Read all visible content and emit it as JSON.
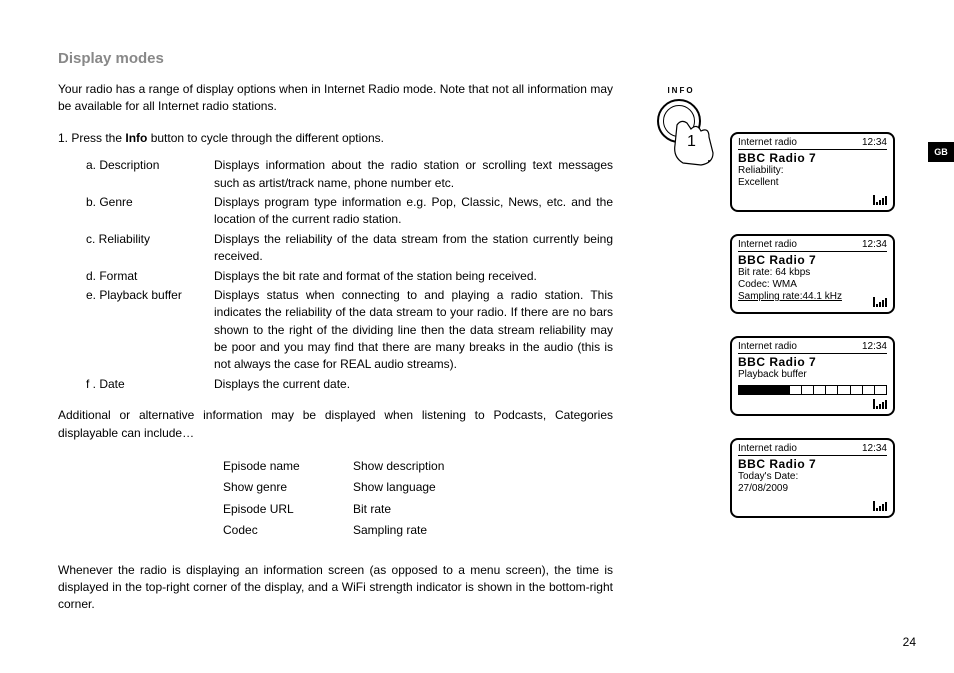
{
  "heading": "Display modes",
  "intro": "Your radio has a range of display options when in Internet Radio mode. Note that not all information may be available for all Internet radio stations.",
  "step1_prefix": "1. Press the ",
  "step1_bold": "Info",
  "step1_suffix": " button to cycle through the different options.",
  "options": [
    {
      "label": "a. Description",
      "desc": "Displays information about the radio station or scrolling text messages such as artist/track name, phone number etc."
    },
    {
      "label": "b. Genre",
      "desc": "Displays program type information e.g. Pop, Classic, News, etc. and the location of the current radio station."
    },
    {
      "label": "c. Reliability",
      "desc": "Displays the reliability of the data stream from the station currently being received."
    },
    {
      "label": "d. Format",
      "desc": "Displays the bit rate and format of the station being received."
    },
    {
      "label": "e. Playback buffer",
      "desc": "Displays status when connecting to and playing a radio station. This indicates the reliability of the data stream to your radio. If there are no bars shown to the right of the dividing line then the data stream reliability may be poor and you may find that there are many breaks in the audio (this is not always the case for REAL audio streams)."
    },
    {
      "label": "f . Date",
      "desc": "Displays the current date."
    }
  ],
  "additional": "Additional or alternative information may be displayed when listening to Podcasts, Categories displayable can include…",
  "podcast_grid": [
    [
      "Episode name",
      "Show description"
    ],
    [
      "Show genre",
      "Show language"
    ],
    [
      "Episode URL",
      "Bit rate"
    ],
    [
      "Codec",
      "Sampling rate"
    ]
  ],
  "closing": "Whenever the radio is displaying an information screen (as opposed to a menu screen), the time is displayed in the top-right corner of the display, and a WiFi strength indicator is shown in the bottom-right corner.",
  "info_label": "INFO",
  "step_num": "1",
  "gb": "GB",
  "screens": {
    "header_mode": "Internet radio",
    "header_time": "12:34",
    "station": "BBC Radio 7",
    "s1": {
      "l1": "Reliability:",
      "l2": "Excellent"
    },
    "s2": {
      "l1": "Bit rate: 64 kbps",
      "l2": "Codec: WMA",
      "l3": "Sampling rate:44.1 kHz"
    },
    "s3": {
      "l1": "Playback buffer"
    },
    "s4": {
      "l1": "Today's Date:",
      "l2": "27/08/2009"
    }
  },
  "page_num": "24"
}
